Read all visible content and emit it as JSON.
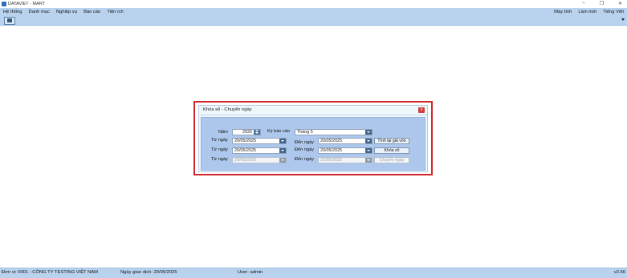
{
  "window": {
    "title": "DATAVIET - MART",
    "controls": [
      "–",
      "❐",
      "✕"
    ]
  },
  "menu": {
    "left": [
      "Hệ thống",
      "Danh mục",
      "Nghiệp vụ",
      "Báo cáo",
      "Tiện ích"
    ],
    "right": [
      "Máy tính",
      "Làm mới",
      "Tiếng Việt"
    ]
  },
  "toolbar": {
    "save_icon": "save-icon"
  },
  "dialog": {
    "title": "Khóa sổ - Chuyển ngày",
    "close": "x",
    "year_label": "Năm",
    "year_value": "2025",
    "period_label": "Kỳ báo cáo",
    "period_value": "Tháng 5",
    "rows": [
      {
        "from_label": "Từ ngày",
        "from_value": "20/05/2025",
        "to_label": "Đến ngày",
        "to_value": "20/05/2025",
        "button": "Tính lại giá vốn"
      },
      {
        "from_label": "Từ ngày",
        "from_value": "20/05/2025",
        "to_label": "Đến ngày",
        "to_value": "20/05/2025",
        "button": "Khóa sổ"
      },
      {
        "from_label": "Từ ngày",
        "from_value": "20/05/2025",
        "to_label": "Đến ngày",
        "to_value": "21/05/2025",
        "button": "Chuyển ngày"
      }
    ]
  },
  "status": {
    "unit": "Đơn vị: 0001 - CÔNG TY TESTING VIỆT NAM",
    "date": "Ngày giao dịch: 20/05/2025",
    "user": "User: admin",
    "version": "v2.66"
  },
  "colors": {
    "accent": "#b9d3ef",
    "highlight": "#d0272d",
    "dialog_body": "#adc8ec"
  }
}
